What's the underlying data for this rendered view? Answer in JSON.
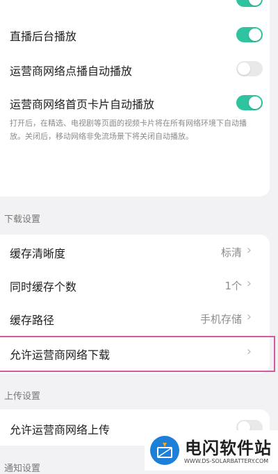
{
  "playback": {
    "rows": [
      {
        "label": "",
        "toggle": "on"
      },
      {
        "label": "直播后台播放",
        "toggle": "on"
      },
      {
        "label": "运营商网络点播自动播放",
        "toggle": "off"
      },
      {
        "label": "运营商网络首页卡片自动播放",
        "toggle": "on"
      }
    ],
    "description": "打开后，在精选、电视剧等页面的视频卡片将在所有网络环境下自动播放。关闭后，移动网络非免流场景下将关闭自动播放。"
  },
  "download": {
    "section_title": "下载设置",
    "rows": [
      {
        "label": "缓存清晰度",
        "value": "标清",
        "chevron": "›"
      },
      {
        "label": "同时缓存个数",
        "value": "1个",
        "chevron": "›"
      },
      {
        "label": "缓存路径",
        "value": "手机存储",
        "chevron": "›"
      },
      {
        "label": "允许运营商网络下载",
        "value": "",
        "chevron": "›"
      }
    ]
  },
  "upload": {
    "section_title": "上传设置",
    "rows": [
      {
        "label": "允许运营商网络上传",
        "toggle": "off"
      }
    ]
  },
  "notify": {
    "section_title": "通知设置"
  },
  "watermark": {
    "brand": "电闪软件站",
    "url": "WWW.DS-SOLARBATTERY.COM"
  },
  "colors": {
    "toggle_on": "#2fc3a0",
    "highlight_border": "#d45aa0"
  }
}
